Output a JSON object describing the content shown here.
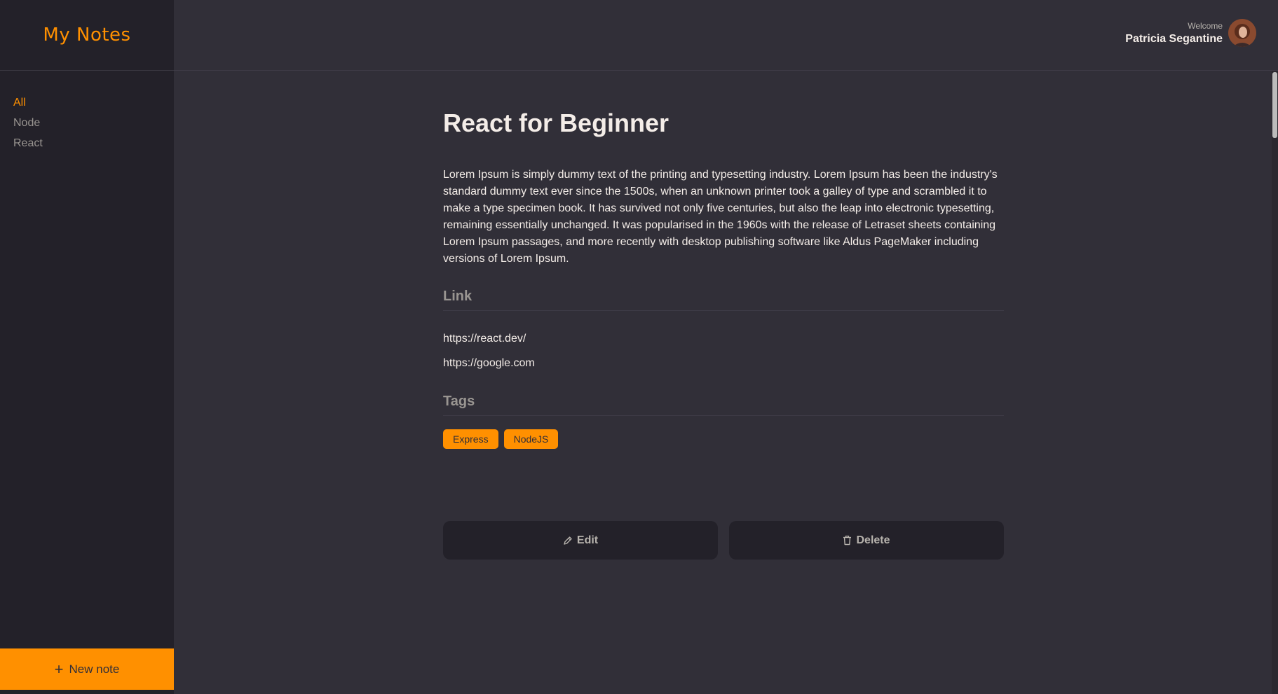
{
  "brand": {
    "name": "My Notes"
  },
  "sidebar": {
    "items": [
      {
        "label": "All",
        "active": true
      },
      {
        "label": "Node",
        "active": false
      },
      {
        "label": "React",
        "active": false
      }
    ],
    "new_note_label": "New note"
  },
  "header": {
    "welcome": "Welcome",
    "user_name": "Patricia Segantine"
  },
  "note": {
    "title": "React for Beginner",
    "description": "Lorem Ipsum is simply dummy text of the printing and typesetting industry. Lorem Ipsum has been the industry's standard dummy text ever since the 1500s, when an unknown printer took a galley of type and scrambled it to make a type specimen book. It has survived not only five centuries, but also the leap into electronic typesetting, remaining essentially unchanged. It was popularised in the 1960s with the release of Letraset sheets containing Lorem Ipsum passages, and more recently with desktop publishing software like Aldus PageMaker including versions of Lorem Ipsum.",
    "links_heading": "Link",
    "links": [
      "https://react.dev/",
      "https://google.com"
    ],
    "tags_heading": "Tags",
    "tags": [
      "Express",
      "NodeJS"
    ]
  },
  "actions": {
    "edit_label": "Edit",
    "delete_label": "Delete"
  },
  "colors": {
    "accent": "#ff9000",
    "background": "#312f38",
    "sidebar": "#232129",
    "text": "#f4ede8",
    "muted": "#999591"
  },
  "icons": {
    "new_note": "plus-icon",
    "edit": "pencil-icon",
    "delete": "trash-icon"
  }
}
